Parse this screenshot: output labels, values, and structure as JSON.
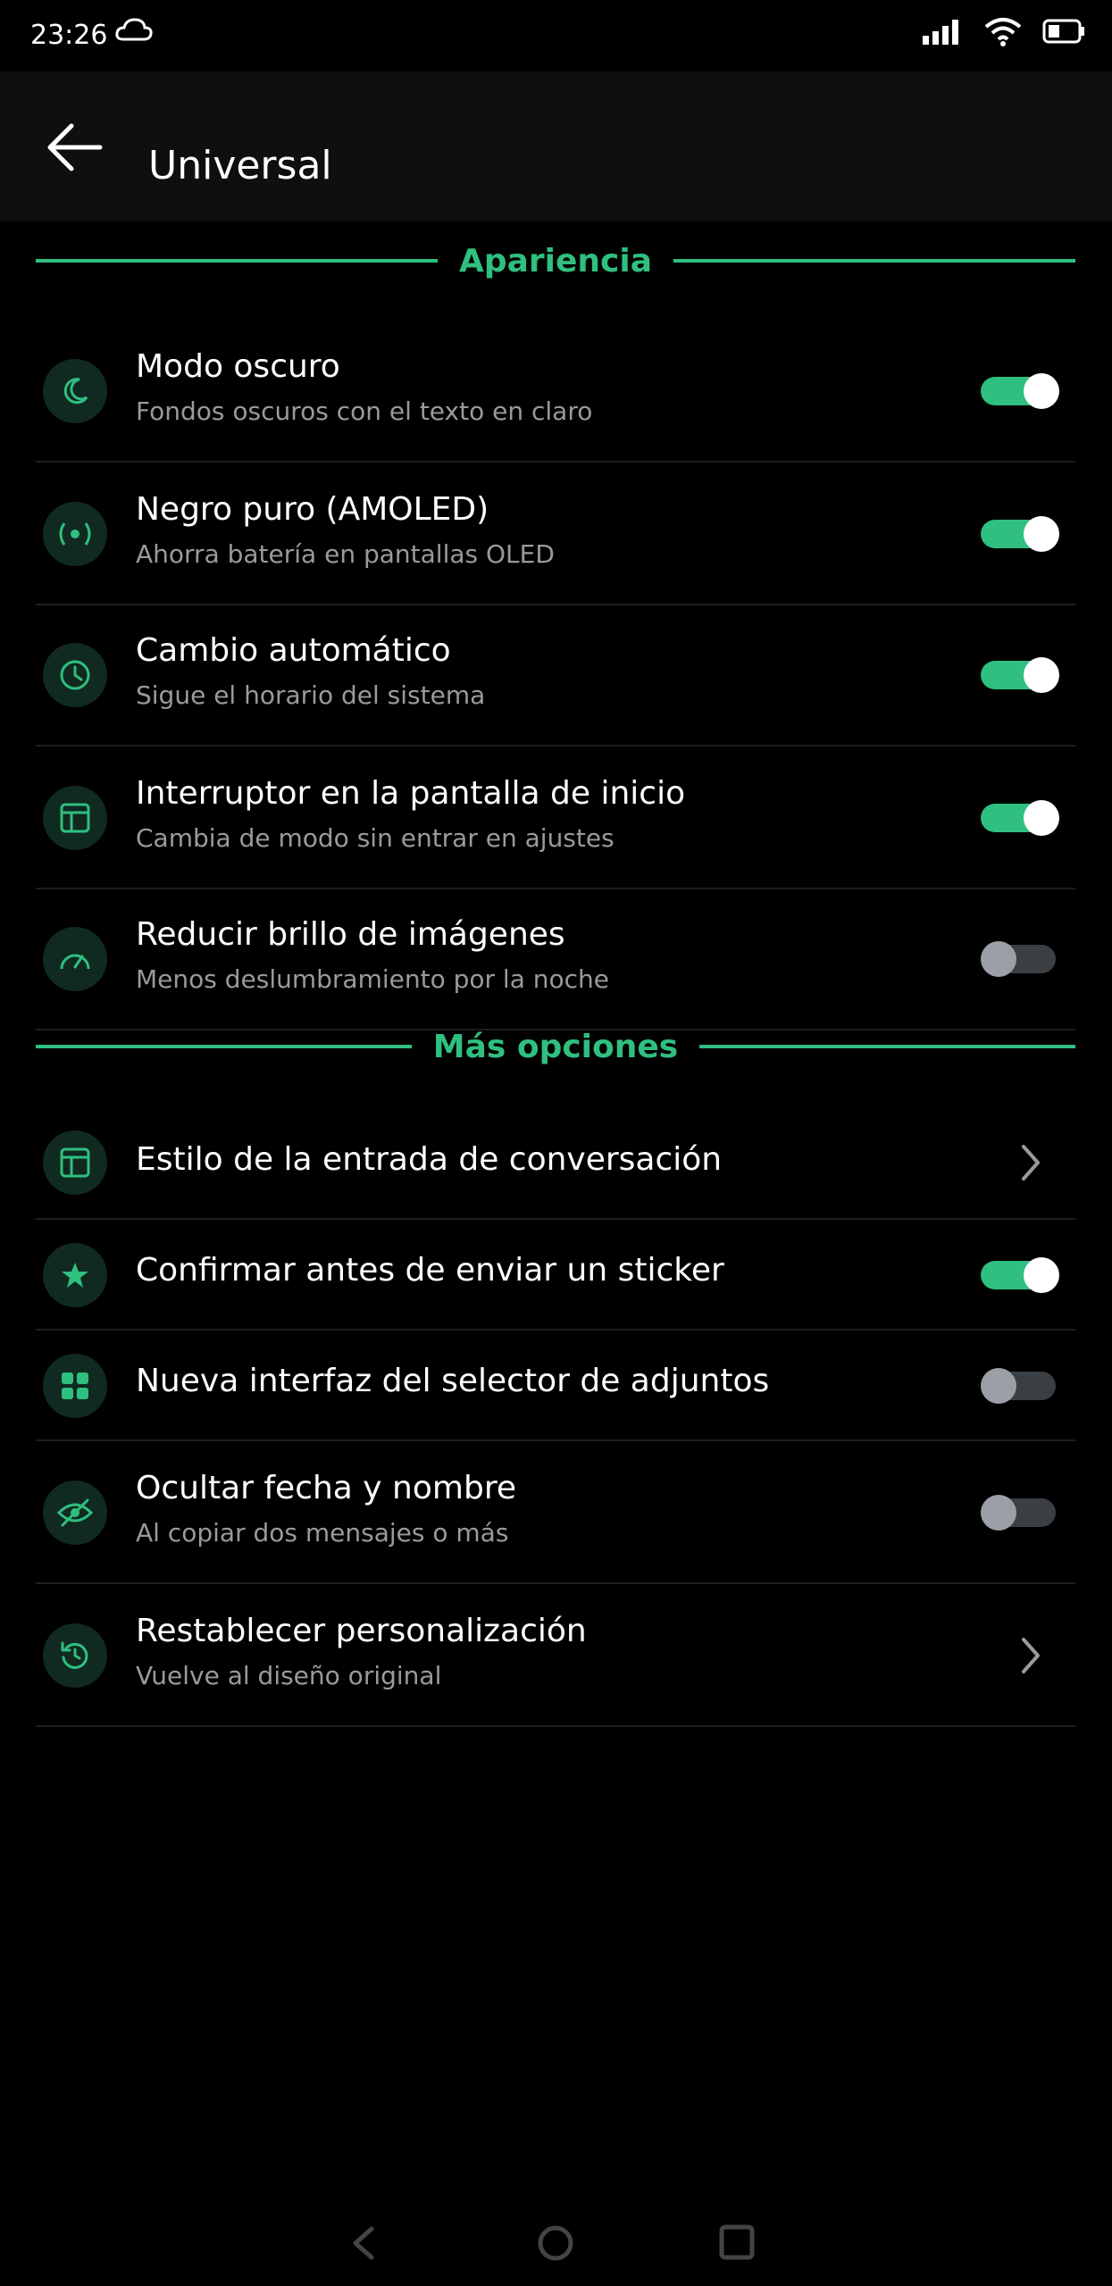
{
  "status": {
    "time": "23:26"
  },
  "app_bar": {
    "title": "Universal"
  },
  "sections": {
    "appearance": {
      "label": "Apariencia"
    },
    "more": {
      "label": "Más opciones"
    }
  },
  "rows": [
    {
      "title": "Modo oscuro",
      "subtitle": "Fondos oscuros con el texto en claro",
      "control": "toggle",
      "on": true,
      "icon": "moon-icon"
    },
    {
      "title": "Negro puro (AMOLED)",
      "subtitle": "Ahorra batería en pantallas OLED",
      "control": "toggle",
      "on": true,
      "icon": "radio-icon"
    },
    {
      "title": "Cambio automático",
      "subtitle": "Sigue el horario del sistema",
      "control": "toggle",
      "on": true,
      "icon": "clock-icon"
    },
    {
      "title": "Interruptor en la pantalla de inicio",
      "subtitle": "Cambia de modo sin entrar en ajustes",
      "control": "toggle",
      "on": true,
      "icon": "layout-icon"
    },
    {
      "title": "Reducir brillo de imágenes",
      "subtitle": "Menos deslumbramiento por la noche",
      "control": "toggle",
      "on": false,
      "icon": "gauge-icon"
    },
    {
      "title": "Estilo de la entrada de conversación",
      "subtitle": "",
      "control": "chevron",
      "icon": "layout-icon"
    },
    {
      "title": "Confirmar antes de enviar un sticker",
      "subtitle": "",
      "control": "toggle",
      "on": true,
      "icon": "star-icon"
    },
    {
      "title": "Nueva interfaz del selector de adjuntos",
      "subtitle": "",
      "control": "toggle",
      "on": false,
      "icon": "grid-icon"
    },
    {
      "title": "Ocultar fecha y nombre",
      "subtitle": "Al copiar dos mensajes o más",
      "control": "toggle",
      "on": false,
      "icon": "eye-off-icon"
    },
    {
      "title": "Restablecer personalización",
      "subtitle": "Vuelve al diseño original",
      "control": "chevron",
      "icon": "reset-icon"
    }
  ],
  "colors": {
    "accent": "#2fbf7f",
    "background": "#000000",
    "app_bar": "#0f0f0f",
    "icon_bg": "#102a21"
  }
}
